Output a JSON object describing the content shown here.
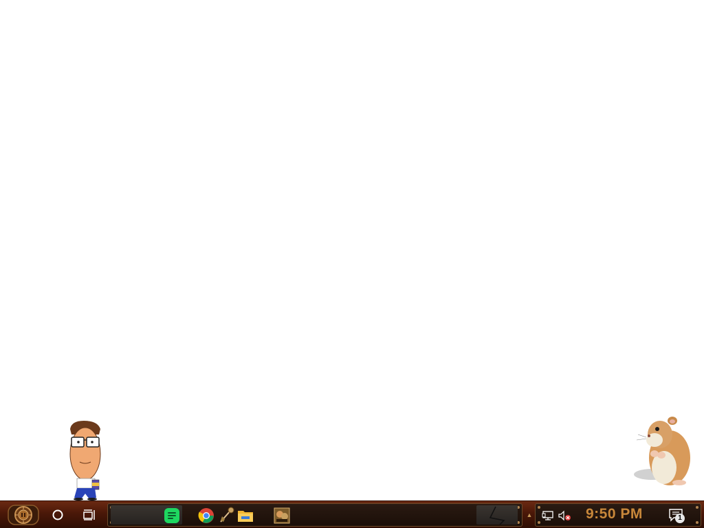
{
  "desktop": {
    "mascots": [
      "cartoon-man-mascot",
      "hamster-mascot"
    ]
  },
  "taskbar": {
    "start_icon": "steampunk-start-orb-icon",
    "search_icon": "cortana-circle-icon",
    "taskview_icon": "task-view-icon",
    "apps": [
      {
        "name": "spotify-icon",
        "color": "#1ed760"
      },
      {
        "name": "chrome-icon",
        "color": "#db4437"
      },
      {
        "name": "feather-brush-icon",
        "color": "#c8a060"
      },
      {
        "name": "file-explorer-icon",
        "color": "#f2b632"
      },
      {
        "name": "game-thumbnail-icon",
        "color": "#7a5a2a"
      }
    ],
    "tray": {
      "network_icon": "network-icon",
      "volume_icon": "volume-muted-icon",
      "clock": "9:50 PM",
      "notifications_icon": "action-center-icon",
      "notifications_count": "1"
    },
    "accent_color": "#c8873a",
    "background_color": "#4a1808"
  }
}
